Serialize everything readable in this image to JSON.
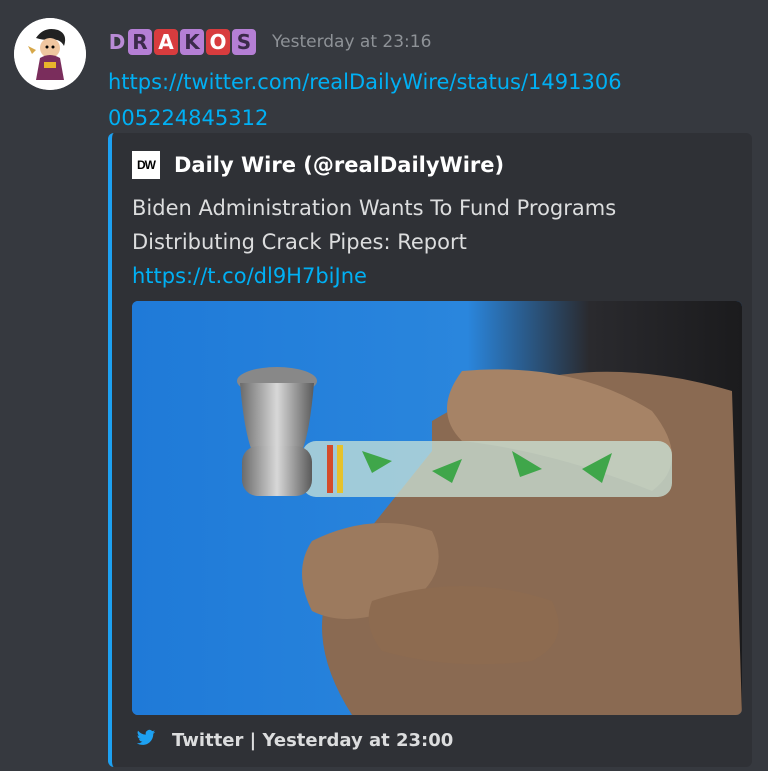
{
  "message": {
    "author_letters": [
      "D",
      "R",
      "A",
      "K",
      "O",
      "S"
    ],
    "timestamp": "Yesterday at 23:16",
    "link": "https://twitter.com/realDailyWire/status/1491306005224845312"
  },
  "embed": {
    "accent_color": "#1da1f2",
    "author_icon_text": "DW",
    "author_name": "Daily Wire (@realDailyWire)",
    "description": "Biden Administration Wants To Fund Programs Distributing Crack Pipes: Report",
    "description_link": "https://t.co/dl9H7biJne",
    "footer_icon": "twitter-bird-icon",
    "footer_text": "Twitter | Yesterday at 23:00"
  }
}
